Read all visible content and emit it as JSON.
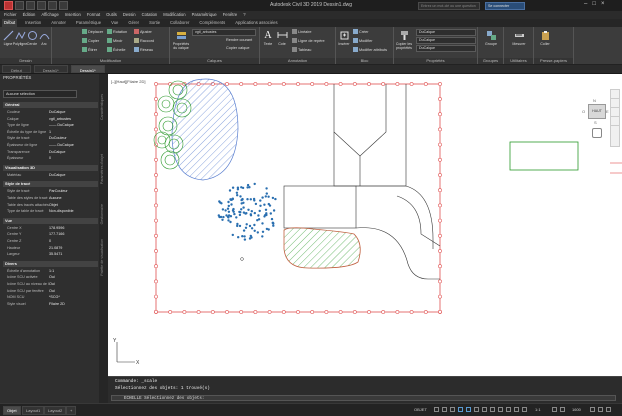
{
  "window": {
    "title": "Autodesk Civil 3D 2019   Dessin1.dwg",
    "search_placeholder": "Entrez un mot-clé ou une question",
    "signin_label": "Se connecter",
    "controls": [
      "–",
      "□",
      "×"
    ]
  },
  "menubar": [
    "Fichier",
    "Édition",
    "Affichage",
    "Insertion",
    "Format",
    "Outils",
    "Dessin",
    "Cotation",
    "Modification",
    "Paramétrique",
    "Fenêtre",
    "?"
  ],
  "ribbon_tabs": [
    {
      "label": "Début",
      "active": true
    },
    {
      "label": "Insertion"
    },
    {
      "label": "Annoter"
    },
    {
      "label": "Paramétrique"
    },
    {
      "label": "Vue"
    },
    {
      "label": "Gérer"
    },
    {
      "label": "Sortie"
    },
    {
      "label": "Collaborer"
    },
    {
      "label": "Compléments"
    },
    {
      "label": "Applications associées"
    }
  ],
  "ribbon": {
    "draw": {
      "title": "Dessin",
      "tools": [
        "Ligne",
        "Polyligne",
        "Cercle",
        "Arc"
      ]
    },
    "modify": {
      "title": "Modification",
      "tools": [
        "Déplacer",
        "Rotation",
        "Ajuster",
        "Copier",
        "Miroir",
        "Raccord",
        "Étirer",
        "Échelle",
        "Réseau"
      ]
    },
    "layers": {
      "title": "Calques",
      "props_label": "Propriétés du calque",
      "layer_combo": "vgtl_arbustes",
      "tools": [
        "Rendre courant",
        "Copier calque"
      ]
    },
    "annotation": {
      "title": "Annotation",
      "text_label": "Texte",
      "cote_label": "Cote",
      "tools": [
        "Linéaire",
        "Ligne de repère",
        "Tableau"
      ]
    },
    "block": {
      "title": "Bloc",
      "insert_label": "Insérer",
      "tools": [
        "Créer",
        "Modifier",
        "Modifier attributs"
      ]
    },
    "properties": {
      "title": "Propriétés",
      "match_label": "Copier les propriétés",
      "combos": [
        "DuCalque",
        "DuCalque",
        "DuCalque"
      ]
    },
    "groups": {
      "title": "Groupes",
      "label": "Groupe"
    },
    "utilities": {
      "title": "Utilitaires",
      "label": "Mesurer"
    },
    "clipboard": {
      "title": "Presse-papiers",
      "label": "Coller"
    }
  },
  "doc_tabs": [
    {
      "label": "Début"
    },
    {
      "label": "Dessin1*"
    },
    {
      "label": "Dessin1*",
      "active": true
    }
  ],
  "properties_panel": {
    "title": "PROPRIÉTÉS",
    "selection": "Aucune sélection",
    "sections": [
      {
        "name": "Général",
        "rows": [
          [
            "Couleur",
            "DuCalque"
          ],
          [
            "Calque",
            "vgtl_arbustes"
          ],
          [
            "Type de ligne",
            "—— DuCalque"
          ],
          [
            "Échelle du type de ligne",
            "1"
          ],
          [
            "Style de tracé",
            "DuCouleur"
          ],
          [
            "Épaisseur de ligne",
            "—— DuCalque"
          ],
          [
            "Transparence",
            "DuCalque"
          ],
          [
            "Épaisseur",
            "0"
          ]
        ]
      },
      {
        "name": "Visualisation 3D",
        "rows": [
          [
            "Matériau",
            "DuCalque"
          ]
        ]
      },
      {
        "name": "Style de tracé",
        "rows": [
          [
            "Style de tracé",
            "ParCouleur"
          ],
          [
            "Table des styles de tracé",
            "Aucune"
          ],
          [
            "Table des tracés attachés",
            "Objet"
          ],
          [
            "Type de table de tracé",
            "Non-disponible"
          ]
        ]
      },
      {
        "name": "Vue",
        "rows": [
          [
            "Centre X",
            "178.9596"
          ],
          [
            "Centre Y",
            "177.7166"
          ],
          [
            "Centre Z",
            "0"
          ],
          [
            "Hauteur",
            "21.0879"
          ],
          [
            "Largeur",
            "35.5471"
          ]
        ]
      },
      {
        "name": "Divers",
        "rows": [
          [
            "Échelle d'annotation",
            "1:1"
          ],
          [
            "Icône SCU activée",
            "Oui"
          ],
          [
            "Icône SCU au niveau de l'origine",
            "Oui"
          ],
          [
            "Icône SCU par fenêtre",
            "Oui"
          ],
          [
            "NOM SCU",
            "*SCG*"
          ],
          [
            "Style visuel",
            "Filaire 2D"
          ]
        ]
      }
    ],
    "side_labels": [
      "Caractéristiques",
      "Paramètres d'objet",
      "Gestionnaire",
      "Palette de visualisation"
    ]
  },
  "viewport": {
    "label": "[–][Haut][Filaire 2D]",
    "viewcube": {
      "top": "HAUT",
      "n": "N",
      "s": "S",
      "e": "E",
      "o": "O"
    }
  },
  "command": {
    "lines": [
      "Commande: _scale",
      "Sélectionnez des objets: 1 trouvé(s)"
    ],
    "prompt": "ECHELLE Sélectionnez des objets:"
  },
  "statusbar": {
    "tabs": [
      {
        "label": "Objet",
        "active": true
      },
      {
        "label": "Layout1"
      },
      {
        "label": "Layout2"
      }
    ],
    "mode": "OBJET",
    "scale": "1:1",
    "zoom": "1600"
  },
  "colors": {
    "accent": "#2a4d78",
    "hatch_blue": "#5a7fd0",
    "tree_green": "#2e9a2e",
    "fence_red": "#e05050",
    "shrub_blue": "#2a6fb0"
  }
}
